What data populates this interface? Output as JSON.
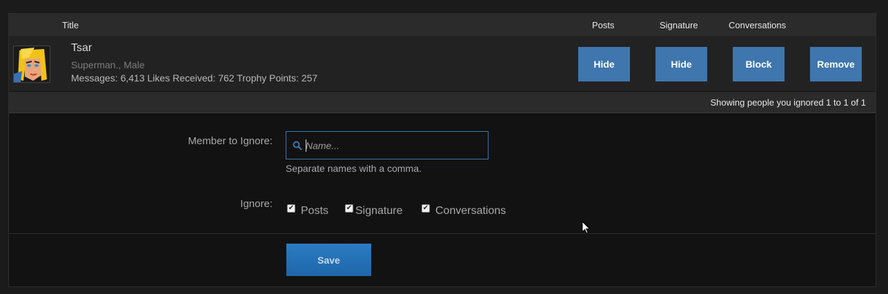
{
  "table": {
    "headers": {
      "title": "Title",
      "posts": "Posts",
      "signature": "Signature",
      "conversations": "Conversations"
    },
    "rows": [
      {
        "name": "Tsar",
        "user_title": "Superman., Male",
        "stats": "Messages: 6,413 Likes Received: 762 Trophy Points: 257",
        "buttons": {
          "posts": "Hide",
          "signature": "Hide",
          "conversations": "Block",
          "remove": "Remove"
        }
      }
    ],
    "footer": "Showing people you ignored 1 to 1 of 1"
  },
  "form": {
    "member_label": "Member to Ignore:",
    "member_placeholder": "Name...",
    "member_hint": "Separate names with a comma.",
    "ignore_label": "Ignore:",
    "options": [
      {
        "label": "Posts",
        "checked": true
      },
      {
        "label": "Signature",
        "checked": true
      },
      {
        "label": "Conversations",
        "checked": true
      }
    ],
    "save_label": "Save"
  },
  "icons": {
    "search": "search-icon",
    "checkbox": "checkmark-icon",
    "cursor": "mouse-pointer-icon"
  },
  "colors": {
    "accent": "#3e76ad",
    "background": "#121212",
    "header": "#2b2b2b"
  }
}
